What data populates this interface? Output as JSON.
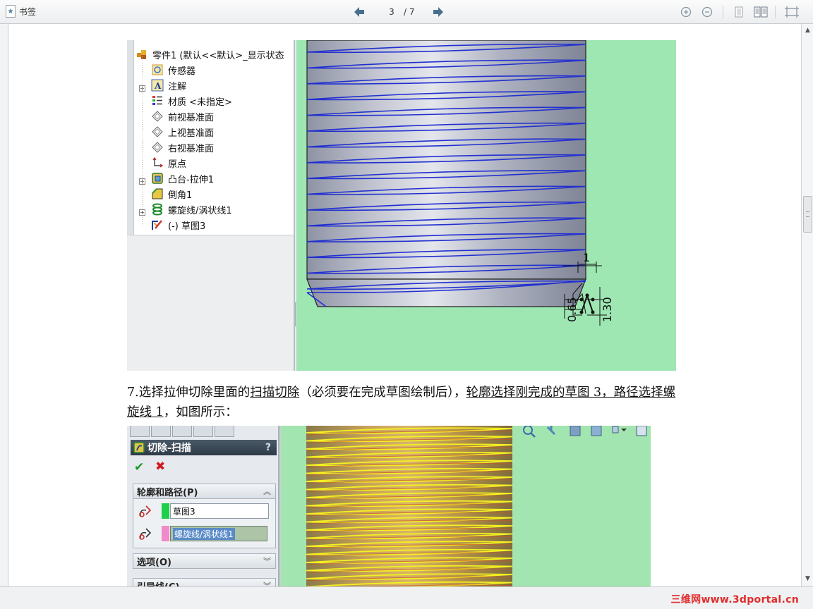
{
  "toolbar": {
    "bookmark_label": "书签",
    "current_page": "3",
    "page_total": "/ 7"
  },
  "figure1": {
    "tree_items": [
      {
        "label": "零件1    (默认<<默认>_显示状态",
        "icon": "part-icon"
      },
      {
        "label": "传感器",
        "icon": "sensor-icon"
      },
      {
        "label": "注解",
        "icon": "annotation-icon"
      },
      {
        "label": "材质 <未指定>",
        "icon": "material-icon"
      },
      {
        "label": "前视基准面",
        "icon": "plane-icon"
      },
      {
        "label": "上视基准面",
        "icon": "plane-icon"
      },
      {
        "label": "右视基准面",
        "icon": "plane-icon"
      },
      {
        "label": "原点",
        "icon": "origin-icon"
      },
      {
        "label": "凸台-拉伸1",
        "icon": "extrude-icon"
      },
      {
        "label": "倒角1",
        "icon": "chamfer-icon"
      },
      {
        "label": "螺旋线/涡状线1",
        "icon": "helix-icon"
      },
      {
        "label": "(-) 草图3",
        "icon": "sketch-icon"
      }
    ],
    "dimensions": {
      "top": "1",
      "left": "0.65",
      "right": "1.30"
    }
  },
  "paragraph": {
    "part1": "7.选择拉伸切除里面的",
    "link1": "扫描切除",
    "part2": "（必须要在完成草图绘制后），",
    "link2": "轮廓选择刚完成的草图 3，路径选择螺旋线 1",
    "part3": "，如图所示："
  },
  "figure2": {
    "title": "切除-扫描",
    "help": "?",
    "ok": "✔",
    "cancel": "✖",
    "group1": "轮廓和路径(P)",
    "profile_value": "草图3",
    "path_value": "螺旋线/涡状线1",
    "group2": "选项(O)",
    "group3": "引导线(C)"
  },
  "watermark": "三维网www.3dportal.cn",
  "colors": {
    "cad_background": "#9ee6b2",
    "helix_blue": "#1f2fd0",
    "helix_yellow": "#f4f022",
    "profile_swatch": "#1fcf4a",
    "path_swatch": "#f08ac8"
  }
}
